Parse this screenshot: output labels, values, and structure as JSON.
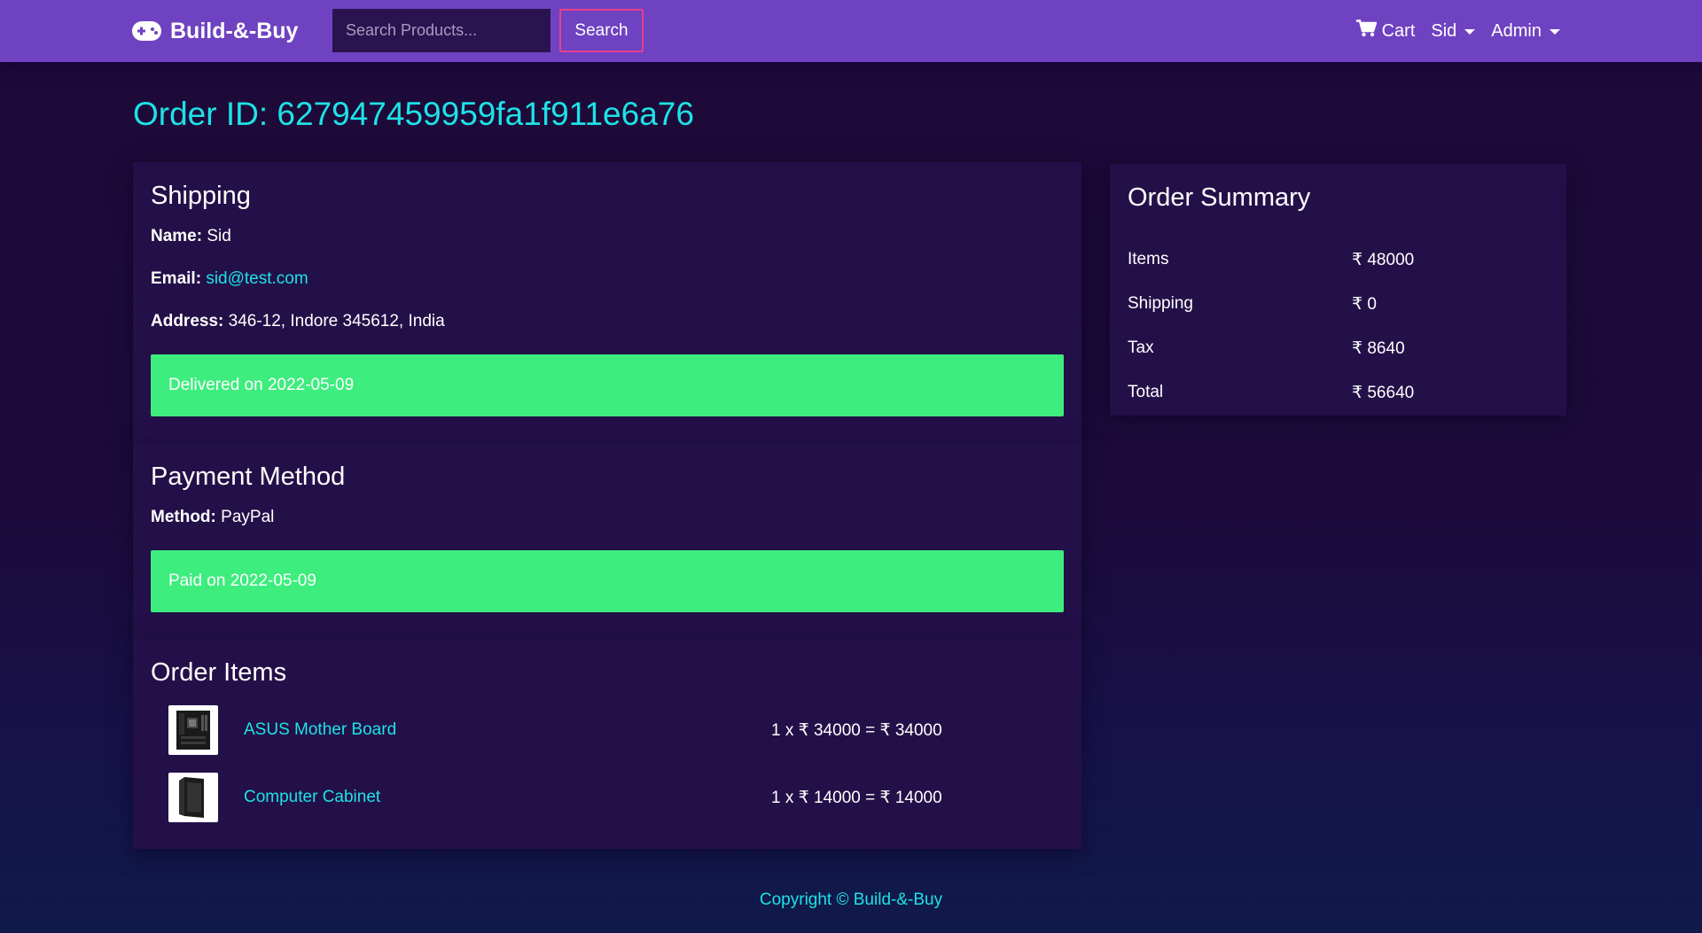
{
  "navbar": {
    "brand": "Build-&-Buy",
    "search_placeholder": "Search Products...",
    "search_button": "Search",
    "cart_label": "Cart",
    "user_label": "Sid",
    "admin_label": "Admin",
    "icons": {
      "brand": "gamepad-icon",
      "cart": "shopping-cart-icon"
    }
  },
  "order": {
    "title": "Order ID: 627947459959fa1f911e6a76"
  },
  "shipping": {
    "heading": "Shipping",
    "name_label": "Name:",
    "name_value": "Sid",
    "email_label": "Email:",
    "email_value": "sid@test.com",
    "address_label": "Address:",
    "address_value": "346-12, Indore 345612, India",
    "status": "Delivered on 2022-05-09"
  },
  "payment": {
    "heading": "Payment Method",
    "method_label": "Method:",
    "method_value": "PayPal",
    "status": "Paid on 2022-05-09"
  },
  "order_items": {
    "heading": "Order Items",
    "items": [
      {
        "name": "ASUS Mother Board",
        "calc": "1 x ₹ 34000 = ₹ 34000",
        "icon": "motherboard-image"
      },
      {
        "name": "Computer Cabinet",
        "calc": "1 x ₹ 14000 = ₹ 14000",
        "icon": "computer-cabinet-image"
      }
    ]
  },
  "summary": {
    "heading": "Order Summary",
    "rows": [
      {
        "label": "Items",
        "value": "₹ 48000"
      },
      {
        "label": "Shipping",
        "value": "₹ 0"
      },
      {
        "label": "Tax",
        "value": "₹ 8640"
      },
      {
        "label": "Total",
        "value": "₹ 56640"
      }
    ]
  },
  "footer": {
    "text": "Copyright © Build-&-Buy"
  },
  "colors": {
    "navbar": "#6f42c1",
    "accent_cyan": "#1ee2e6",
    "success_green": "#3ded7e",
    "card_bg": "#231048",
    "search_border": "#e83e8c"
  }
}
